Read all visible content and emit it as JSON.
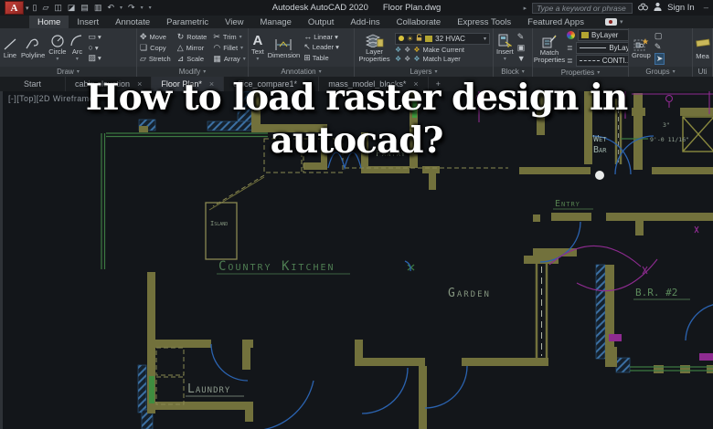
{
  "titlebar": {
    "logo": "A",
    "app_title": "Autodesk AutoCAD 2020",
    "doc_title": "Floor Plan.dwg",
    "search_placeholder": "Type a keyword or phrase",
    "sign_in_label": "Sign In"
  },
  "ribbon": {
    "tabs": [
      "Home",
      "Insert",
      "Annotate",
      "Parametric",
      "View",
      "Manage",
      "Output",
      "Add-ins",
      "Collaborate",
      "Express Tools",
      "Featured Apps"
    ],
    "draw": {
      "label": "Draw",
      "line": "Line",
      "polyline": "Polyline",
      "circle": "Circle",
      "arc": "Arc"
    },
    "modify": {
      "label": "Modify",
      "move": "Move",
      "rotate": "Rotate",
      "trim": "Trim",
      "copy": "Copy",
      "mirror": "Mirror",
      "fillet": "Fillet",
      "stretch": "Stretch",
      "scale": "Scale",
      "array": "Array"
    },
    "annotation": {
      "label": "Annotation",
      "text": "Text",
      "dimension": "Dimension",
      "linear": "Linear",
      "leader": "Leader",
      "table": "Table"
    },
    "layers": {
      "label": "Layers",
      "layer_properties": "Layer Properties",
      "current_layer": "32 HVAC",
      "make_current": "Make Current",
      "match_layer": "Match Layer"
    },
    "block": {
      "label": "Block",
      "insert": "Insert"
    },
    "properties": {
      "label": "Properties",
      "match_properties": "Match Properties",
      "color": "ByLayer",
      "lineweight": "ByLayer",
      "linetype": "CONTI..."
    },
    "groups": {
      "label": "Groups",
      "group": "Group"
    },
    "utilities": {
      "label": "Uti",
      "measure": "Mea"
    }
  },
  "file_tabs": {
    "tabs": [
      {
        "label": "Start"
      },
      {
        "label": "cabin elevation"
      },
      {
        "label": "Floor Plan*"
      },
      {
        "label": "office_compare1*"
      },
      {
        "label": "mass_model_blocks*"
      }
    ]
  },
  "viewport": {
    "label": "[-][Top][2D Wireframe]"
  },
  "drawing": {
    "labels": {
      "pantry": "Pantry",
      "island": "Island",
      "country_kitchen": "Country Kitchen",
      "entry": "Entry",
      "wet": "Wet",
      "bar": "Bar",
      "garden": "Garden",
      "br2": "B.R. #2",
      "laundry": "Laundry"
    },
    "dims": {
      "width_dim": "9'-0 11/16\"",
      "offset_dim": "3\""
    }
  },
  "overlay": {
    "line1": "How to load raster design in",
    "line2": "autocad?"
  },
  "icons": {
    "caret_down": "▾",
    "caret_right": "▸",
    "close": "×",
    "new_tab": "+",
    "minimize": "–",
    "qat_new": "▯",
    "qat_open": "▱",
    "qat_save": "◫",
    "qat_saveas": "◪",
    "qat_plot": "▤",
    "qat_print": "▥",
    "qat_undo": "↶",
    "qat_redo": "↷",
    "move": "✥",
    "rotate": "↻",
    "trim": "✂",
    "copy": "❏",
    "mirror": "△",
    "fillet": "◠",
    "stretch": "▱",
    "scale": "⊿",
    "array": "▦",
    "erase": "▰",
    "explode": "✶",
    "offset": "⊂",
    "text_a": "A",
    "linear": "↔",
    "leader": "↖",
    "table": "⊞",
    "rect_tool": "▭",
    "ellipse_tool": "○",
    "hatch_tool": "▨",
    "bulb": "●",
    "sun": "☀",
    "swatch": "■",
    "layer_glyph": "❖",
    "block_edit": "✎",
    "block_attr": "▣",
    "block_down": "▼",
    "ungroup": "▢",
    "group_edit": "✎",
    "select": "➤",
    "lineweight": "≣"
  },
  "colors": {
    "wall_olive": "#72713c",
    "counter_green": "#3c7a42",
    "window_green": "#3f9d3f",
    "label_green": "#4e7d52",
    "label_gray_green": "#84957f",
    "door_blue": "#2b63b0",
    "hatch_blue": "#3c70a3",
    "electric_magenta": "#8e2b90",
    "logo_red": "#c8423a",
    "layer_swatch_yellow": "#b3a531"
  }
}
